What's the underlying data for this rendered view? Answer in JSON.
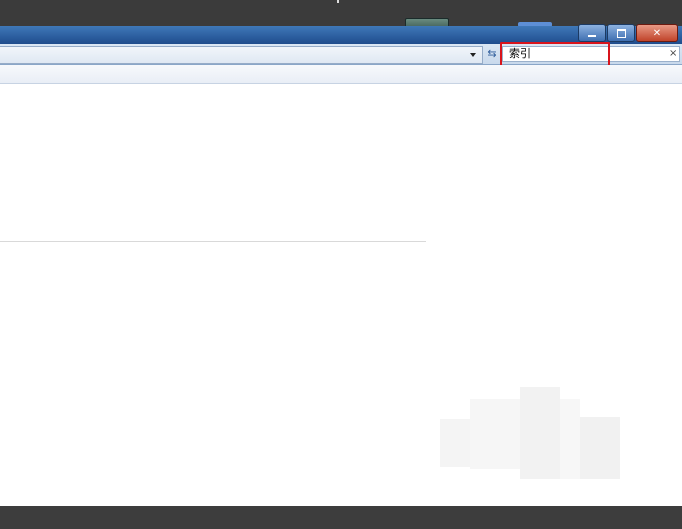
{
  "search": {
    "value": "索引",
    "clear_glyph": "×"
  },
  "icons": {
    "refresh": "refresh-icon",
    "dropdown": "chevron-down-icon",
    "close": "close-icon",
    "minimize": "minimize-icon",
    "maximize": "maximize-icon"
  },
  "window_controls": {
    "close_glyph": "✕"
  },
  "colors": {
    "highlight": "#d8141c",
    "title_bar": "#2f62a3"
  }
}
